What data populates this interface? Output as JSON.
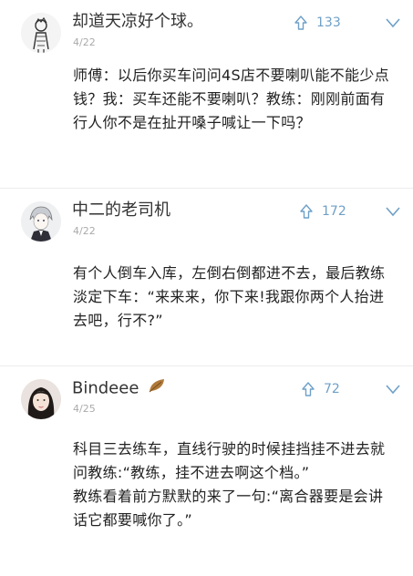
{
  "comments": [
    {
      "username": "却道天凉好个球。",
      "date": "4/22",
      "likes": "133",
      "avatar": "sketch-figure-avatar",
      "text": "师傅：以后你买车问问4S店不要喇叭能不能少点钱？我：买车还能不要喇叭？教练：刚刚前面有行人你不是在扯开嗓子喊让一下吗？"
    },
    {
      "username": "中二的老司机",
      "date": "4/22",
      "likes": "172",
      "avatar": "anime-character-avatar",
      "text": "有个人倒车入库，左倒右倒都进不去，最后教练淡定下车：“来来来，你下来!我跟你两个人抬进去吧，行不?”"
    },
    {
      "username": "Bindeee",
      "username_badge": "leaf-icon",
      "date": "4/25",
      "likes": "72",
      "avatar": "woman-photo-avatar",
      "text": "科目三去练车，直线行驶的时候挂挡挂不进去就问教练:“教练，挂不进去啊这个档。”\n教练看着前方默默的来了一句:“离合器要是会讲话它都要喊你了。”"
    }
  ],
  "colors": {
    "like": "#6fa0c8",
    "divider": "#ececec",
    "date": "#aaaaaa",
    "text": "#222222"
  }
}
